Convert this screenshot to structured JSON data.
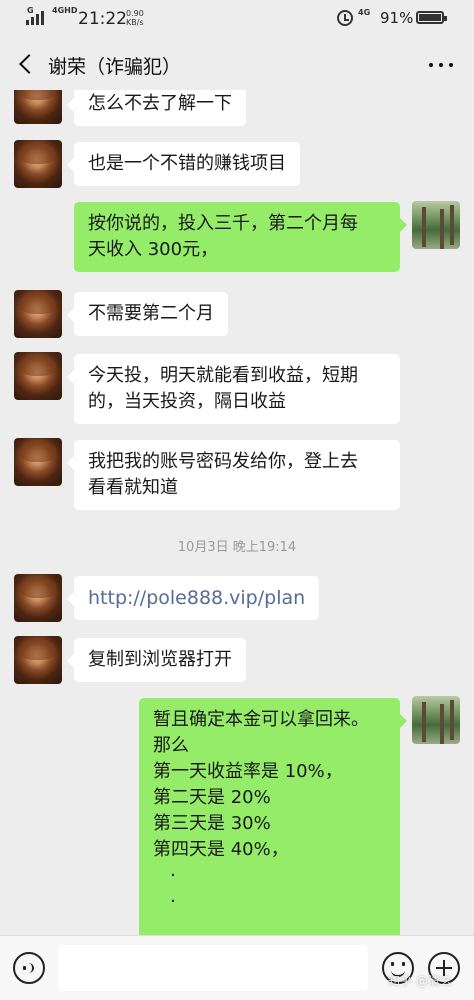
{
  "status_bar": {
    "network_1": "G",
    "network_2": "4GHD",
    "time": "21:22",
    "speed_value": "0.90",
    "speed_unit": "KB/s",
    "network_3": "4G",
    "battery": "91%",
    "icons": [
      "signal-icon",
      "alarm-icon",
      "battery-icon"
    ]
  },
  "header": {
    "title": "谢荣（诈骗犯）",
    "icons": [
      "back-arrow-icon",
      "more-icon"
    ]
  },
  "messages": [
    {
      "side": "in",
      "text": "怎么不去了解一下"
    },
    {
      "side": "in",
      "text": "也是一个不错的赚钱项目"
    },
    {
      "side": "out",
      "text": "按你说的，投入三千，第二个月每\n天收入 300元，"
    },
    {
      "side": "in",
      "text": "不需要第二个月"
    },
    {
      "side": "in",
      "text": "今天投，明天就能看到收益，短期\n的，当天投资，隔日收益"
    },
    {
      "side": "in",
      "text": "我把我的账号密码发给你，登上去\n看看就知道"
    },
    {
      "side": "time",
      "text": "10月3日 晚上19:14"
    },
    {
      "side": "in",
      "text": "http://pole888.vip/plan",
      "is_link": true
    },
    {
      "side": "in",
      "text": "复制到浏览器打开"
    },
    {
      "side": "out",
      "text": "暂且确定本金可以拿回来。\n那么\n第一天收益率是 10%，\n第二天是 20%\n第三天是 30%\n第四天是 40%，\n   ·\n   ·"
    }
  ],
  "input_bar": {
    "placeholder": "",
    "icons": [
      "voice-icon",
      "emoji-icon",
      "plus-icon"
    ]
  },
  "watermark": "知乎 @清玄",
  "colors": {
    "background": "#ededed",
    "outgoing_bubble": "#95ec69",
    "incoming_bubble": "#ffffff",
    "link": "#576b95"
  }
}
